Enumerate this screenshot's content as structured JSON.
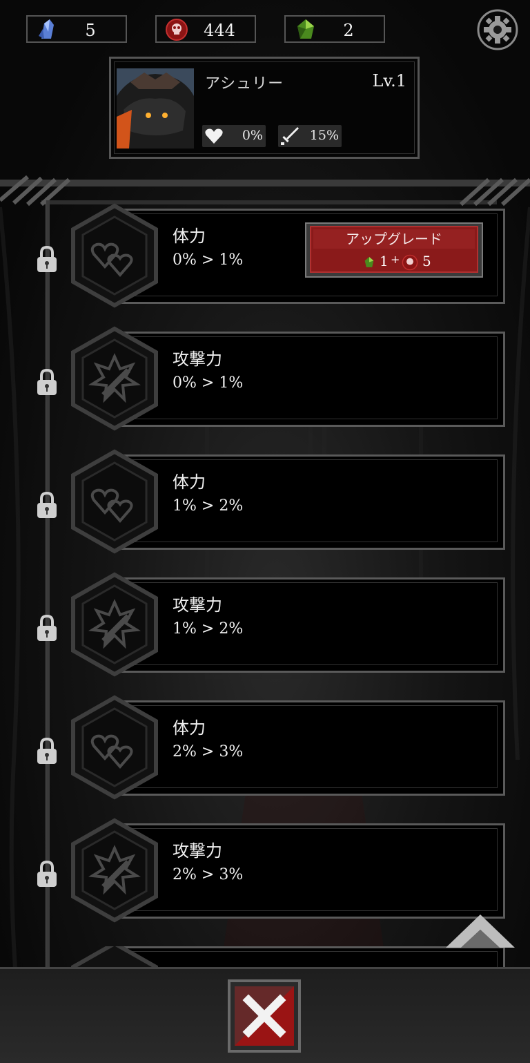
{
  "currencies": [
    {
      "icon": "blue-crystal-icon",
      "value": "5"
    },
    {
      "icon": "red-skull-coin-icon",
      "value": "444"
    },
    {
      "icon": "green-gem-icon",
      "value": "2"
    }
  ],
  "character": {
    "name": "アシュリー",
    "level": "Lv.1",
    "stats": [
      {
        "icon": "heart-icon",
        "value": "0%"
      },
      {
        "icon": "sword-icon",
        "value": "15%"
      }
    ]
  },
  "upgrades": [
    {
      "title": "体力",
      "value": "0% > 1%",
      "icon": "hearts-icon",
      "locked": true,
      "button": {
        "label": "アップグレード",
        "gem_cost": "1",
        "plus": "+",
        "coin_cost": "5"
      }
    },
    {
      "title": "攻撃力",
      "value": "0% > 1%",
      "icon": "sword-burst-icon",
      "locked": true
    },
    {
      "title": "体力",
      "value": "1% > 2%",
      "icon": "hearts-icon",
      "locked": true
    },
    {
      "title": "攻撃力",
      "value": "1% > 2%",
      "icon": "sword-burst-icon",
      "locked": true
    },
    {
      "title": "体力",
      "value": "2% > 3%",
      "icon": "hearts-icon",
      "locked": true
    },
    {
      "title": "攻撃力",
      "value": "2% > 3%",
      "icon": "sword-burst-icon",
      "locked": true
    }
  ],
  "colors": {
    "button_red": "#8a1a1a",
    "frame": "#5a5a5a"
  }
}
